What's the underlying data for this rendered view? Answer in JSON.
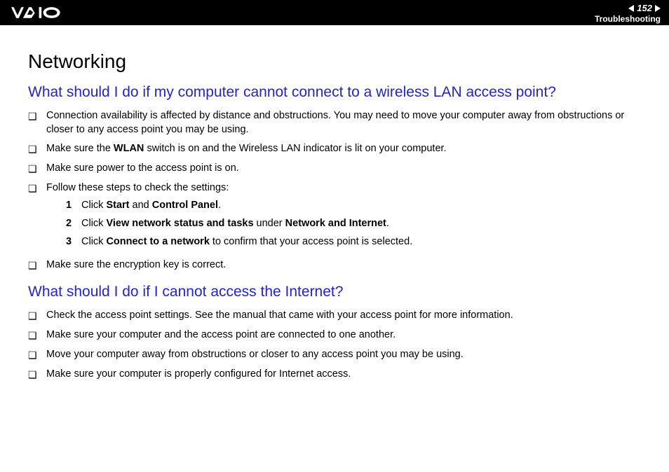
{
  "header": {
    "page_number": "152",
    "section": "Troubleshooting"
  },
  "title": "Networking",
  "q1": {
    "heading": "What should I do if my computer cannot connect to a wireless LAN access point?",
    "items": [
      {
        "text": "Connection availability is affected by distance and obstructions. You may need to move your computer away from obstructions or closer to any access point you may be using."
      },
      {
        "pre": "Make sure the ",
        "bold1": "WLAN",
        "post": " switch is on and the Wireless LAN indicator is lit on your computer."
      },
      {
        "text": "Make sure power to the access point is on."
      },
      {
        "text": "Follow these steps to check the settings:"
      }
    ],
    "steps": [
      {
        "n": "1",
        "pre": "Click ",
        "b1": "Start",
        "mid": " and ",
        "b2": "Control Panel",
        "post": "."
      },
      {
        "n": "2",
        "pre": "Click ",
        "b1": "View network status and tasks",
        "mid": " under ",
        "b2": "Network and Internet",
        "post": "."
      },
      {
        "n": "3",
        "pre": "Click ",
        "b1": "Connect to a network",
        "post": " to confirm that your access point is selected."
      }
    ],
    "item5": {
      "text": "Make sure the encryption key is correct."
    }
  },
  "q2": {
    "heading": "What should I do if I cannot access the Internet?",
    "items": [
      {
        "text": "Check the access point settings. See the manual that came with your access point for more information."
      },
      {
        "text": "Make sure your computer and the access point are connected to one another."
      },
      {
        "text": "Move your computer away from obstructions or closer to any access point you may be using."
      },
      {
        "text": "Make sure your computer is properly configured for Internet access."
      }
    ]
  }
}
